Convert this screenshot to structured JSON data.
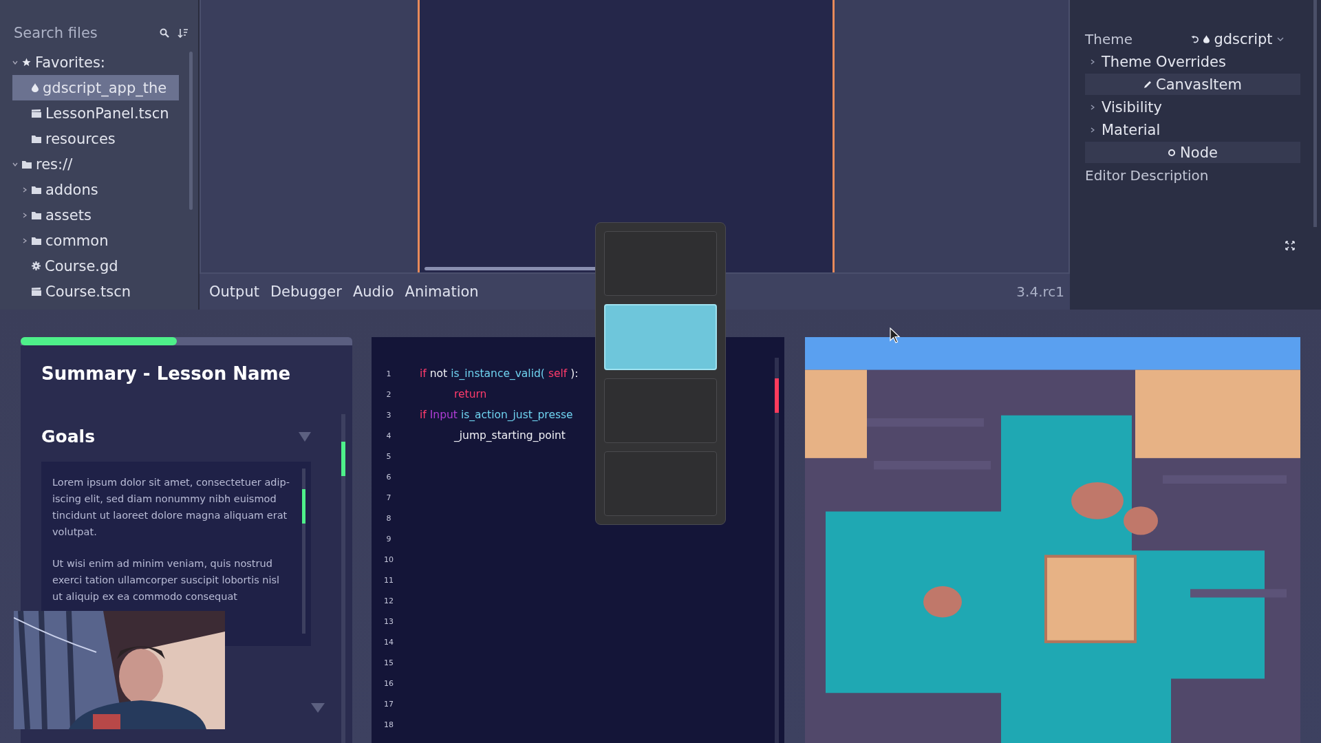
{
  "file_panel": {
    "search": {
      "placeholder": "Search files"
    },
    "tree": [
      {
        "label": "Favorites:",
        "kind": "star",
        "expanded": true,
        "selected": false,
        "children": [
          {
            "label": "gdscript_app_the",
            "kind": "theme",
            "selected": true
          },
          {
            "label": "LessonPanel.tscn",
            "kind": "scene",
            "selected": false
          },
          {
            "label": "resources",
            "kind": "folder",
            "selected": false
          }
        ]
      },
      {
        "label": "res://",
        "kind": "folder",
        "expanded": true,
        "selected": false,
        "children": [
          {
            "label": "addons",
            "kind": "folder",
            "expanded": false,
            "selected": false
          },
          {
            "label": "assets",
            "kind": "folder",
            "expanded": false,
            "selected": false
          },
          {
            "label": "common",
            "kind": "folder",
            "expanded": false,
            "selected": false
          },
          {
            "label": "Course.gd",
            "kind": "script",
            "selected": false
          },
          {
            "label": "Course.tscn",
            "kind": "scene",
            "selected": false
          }
        ]
      }
    ]
  },
  "bottom_tabs": [
    {
      "label": "Output"
    },
    {
      "label": "Debugger"
    },
    {
      "label": "Audio"
    },
    {
      "label": "Animation"
    }
  ],
  "version": "3.4.rc1",
  "inspector": [
    {
      "kind": "property",
      "label": "Theme",
      "value": "gdscript"
    },
    {
      "kind": "section",
      "label": "Theme Overrides"
    },
    {
      "kind": "category",
      "label": "CanvasItem"
    },
    {
      "kind": "section",
      "label": "Visibility"
    },
    {
      "kind": "section",
      "label": "Material"
    },
    {
      "kind": "category",
      "label": "Node"
    },
    {
      "kind": "property",
      "label": "Editor Description"
    }
  ],
  "palette": {
    "swatches": [
      {
        "color": "#2f2f31",
        "selected": false
      },
      {
        "color": "#6ec6db",
        "selected": true
      },
      {
        "color": "#2f2f31",
        "selected": false
      },
      {
        "color": "#2f2f31",
        "selected": false
      }
    ]
  },
  "lesson": {
    "progress": {
      "level": 0.47
    },
    "title": "Summary - Lesson Name",
    "section": "Goals",
    "paragraphs": [
      "Lorem ipsum dolor sit amet, consectetuer adip-iscing elit, sed diam nonummy nibh euismod tincidunt ut laoreet dolore magna aliquam erat volutpat.",
      "Ut wisi enim ad minim veniam, quis nostrud exerci tation ullamcorper suscipit lobortis nisl ut aliquip ex ea commodo consequat"
    ]
  },
  "code": {
    "lines": [
      {
        "number": "1",
        "tokens": [
          {
            "kind": "keyword",
            "text": "if"
          },
          {
            "kind": "plain",
            "text": "not"
          },
          {
            "kind": "func",
            "text": "is_instance_valid("
          },
          {
            "kind": "keyword",
            "text": "self"
          },
          {
            "kind": "plain",
            "text": "):"
          }
        ],
        "children": [
          {
            "number": "2",
            "tokens": [
              {
                "kind": "keyword",
                "text": "return"
              }
            ]
          }
        ]
      },
      {
        "number": "3",
        "tokens": [
          {
            "kind": "keyword",
            "text": "if"
          },
          {
            "kind": "class",
            "text": "Input"
          },
          {
            "kind": "func",
            "text": "is_action_just_presse"
          }
        ],
        "children": [
          {
            "number": "4",
            "tokens": [
              {
                "kind": "plain",
                "text": "_jump_starting_point"
              }
            ]
          }
        ]
      },
      {
        "number": "5"
      },
      {
        "number": "6"
      },
      {
        "number": "7"
      },
      {
        "number": "8"
      },
      {
        "number": "9"
      },
      {
        "number": "10"
      },
      {
        "number": "11"
      },
      {
        "number": "12"
      },
      {
        "number": "13"
      },
      {
        "number": "14"
      },
      {
        "number": "15"
      },
      {
        "number": "16"
      },
      {
        "number": "17"
      },
      {
        "number": "18"
      }
    ]
  }
}
